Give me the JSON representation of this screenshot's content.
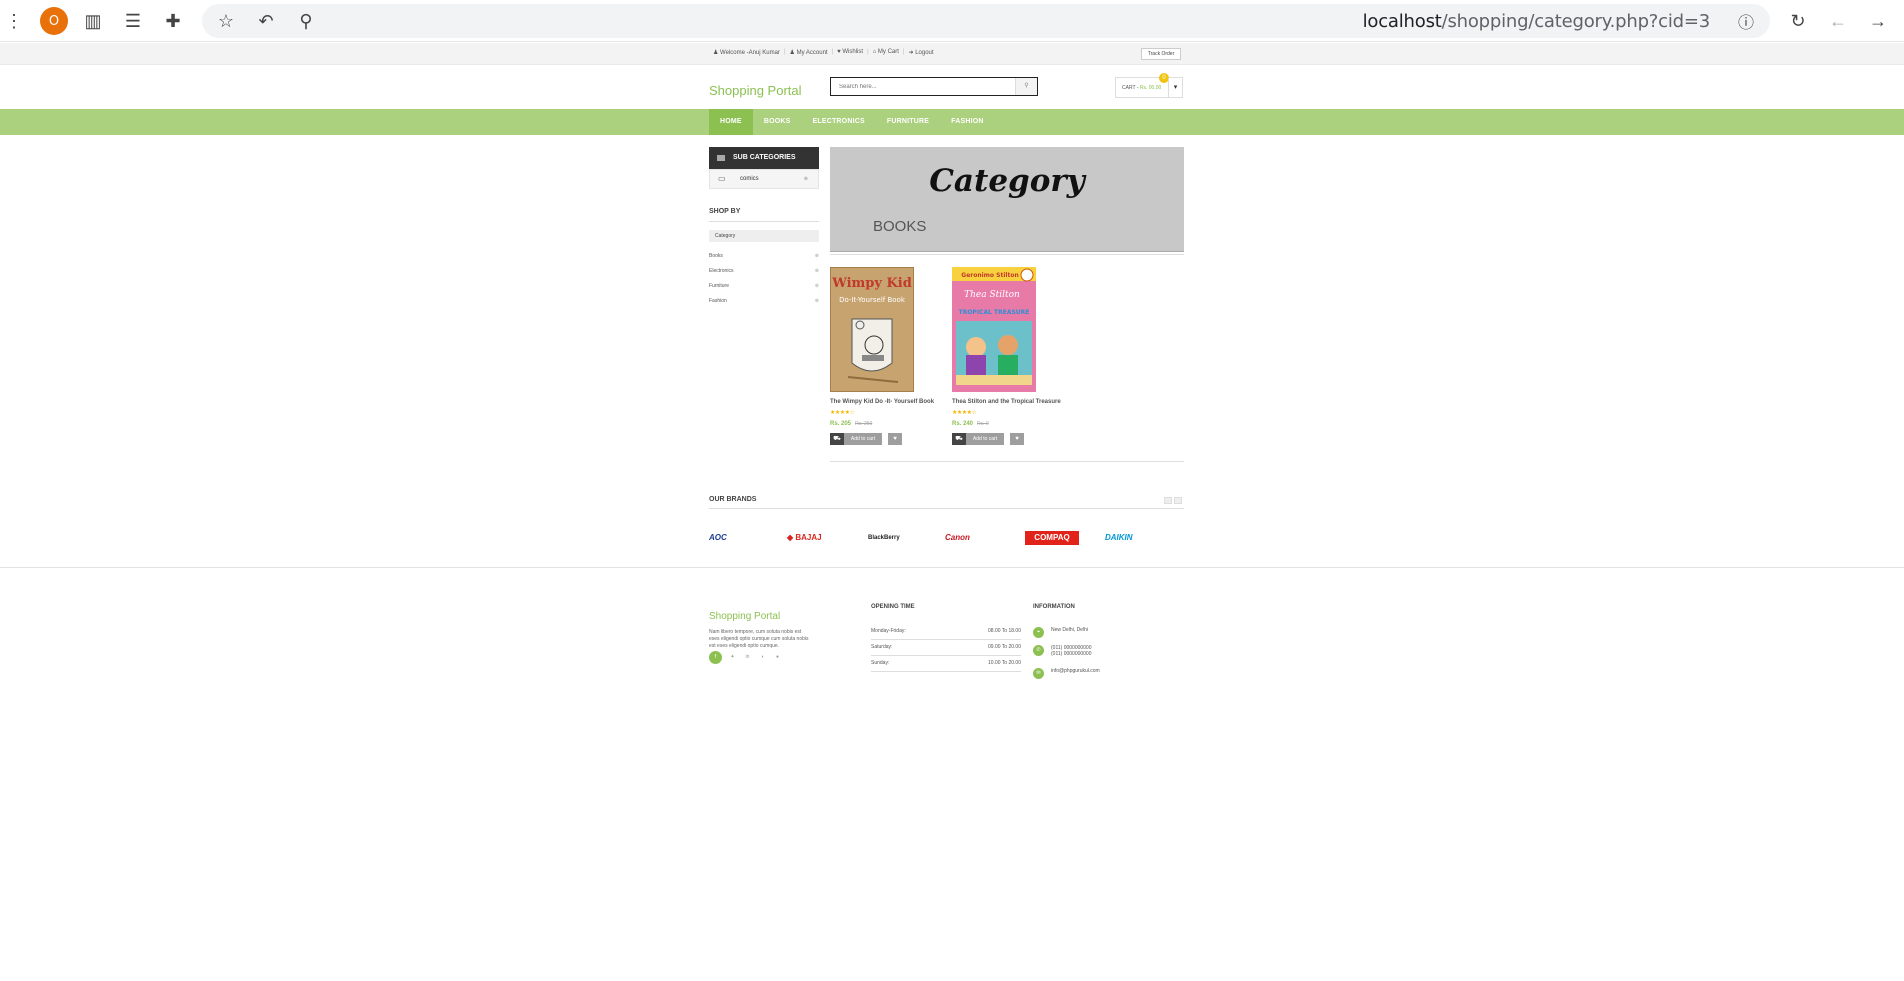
{
  "browser": {
    "avatar_letter": "O",
    "url_host": "localhost",
    "url_path": "/shopping/category.php?cid=3"
  },
  "topbar": {
    "links": [
      "Welcome -Anuj Kumar",
      "My Account",
      "Wishlist",
      "My Cart",
      "Logout"
    ],
    "track_order": "Track Order"
  },
  "header": {
    "logo": "Shopping Portal",
    "search_placeholder": "Search here...",
    "cart_label": "CART -",
    "cart_amount": "Rs. 00.00",
    "cart_count": "0"
  },
  "nav": {
    "items": [
      "HOME",
      "BOOKS",
      "ELECTRONICS",
      "FURNITURE",
      "FASHION"
    ],
    "active": "HOME"
  },
  "sidebar": {
    "sub_categories_title": "SUB CATEGORIES",
    "sub_categories": [
      "comics"
    ],
    "shop_by_title": "SHOP BY",
    "category_label": "Category",
    "categories": [
      "Books",
      "Electronics",
      "Furniture",
      "Fashion"
    ]
  },
  "banner": {
    "title": "Category",
    "subtitle": "BOOKS"
  },
  "products": [
    {
      "name": "The Wimpy Kid Do -It- Yourself Book",
      "price": "Rs. 205",
      "old_price": "Rs. 250",
      "rating": 4,
      "add_to_cart": "Add to cart",
      "cover_title": "Wimpy Kid",
      "cover_subtitle": "Do-It-Yourself Book"
    },
    {
      "name": "Thea Stilton and the Tropical Treasure",
      "price": "Rs. 240",
      "old_price": "Rs. 0",
      "rating": 4,
      "add_to_cart": "Add to cart",
      "cover_title": "Thea Stilton",
      "cover_subtitle": "TROPICAL TREASURE"
    }
  ],
  "brands": {
    "title": "OUR BRANDS",
    "items": [
      "AOC",
      "BAJAJ",
      "BlackBerry",
      "Canon",
      "COMPAQ",
      "DAIKIN"
    ]
  },
  "footer": {
    "logo": "Shopping Portal",
    "description": "Nam libero tempore, cum soluta nobis est eses eligendi optio cumque cum soluta nobis est eses eligendi optio cumque.",
    "opening_time_title": "OPENING TIME",
    "hours": [
      {
        "day": "Monday-Friday:",
        "time": "08.00 To 18.00"
      },
      {
        "day": "Saturday:",
        "time": "09.00 To 20.00"
      },
      {
        "day": "Sunday:",
        "time": "10.00 To 20.00"
      }
    ],
    "information_title": "INFORMATION",
    "address": "New Delhi, Delhi",
    "phone1": "(011) 0000000000",
    "phone2": "(011) 0000000000",
    "email": "info@phpgurukul.com"
  },
  "colors": {
    "brand_green": "#8cc152",
    "nav_green": "#abd07e"
  }
}
